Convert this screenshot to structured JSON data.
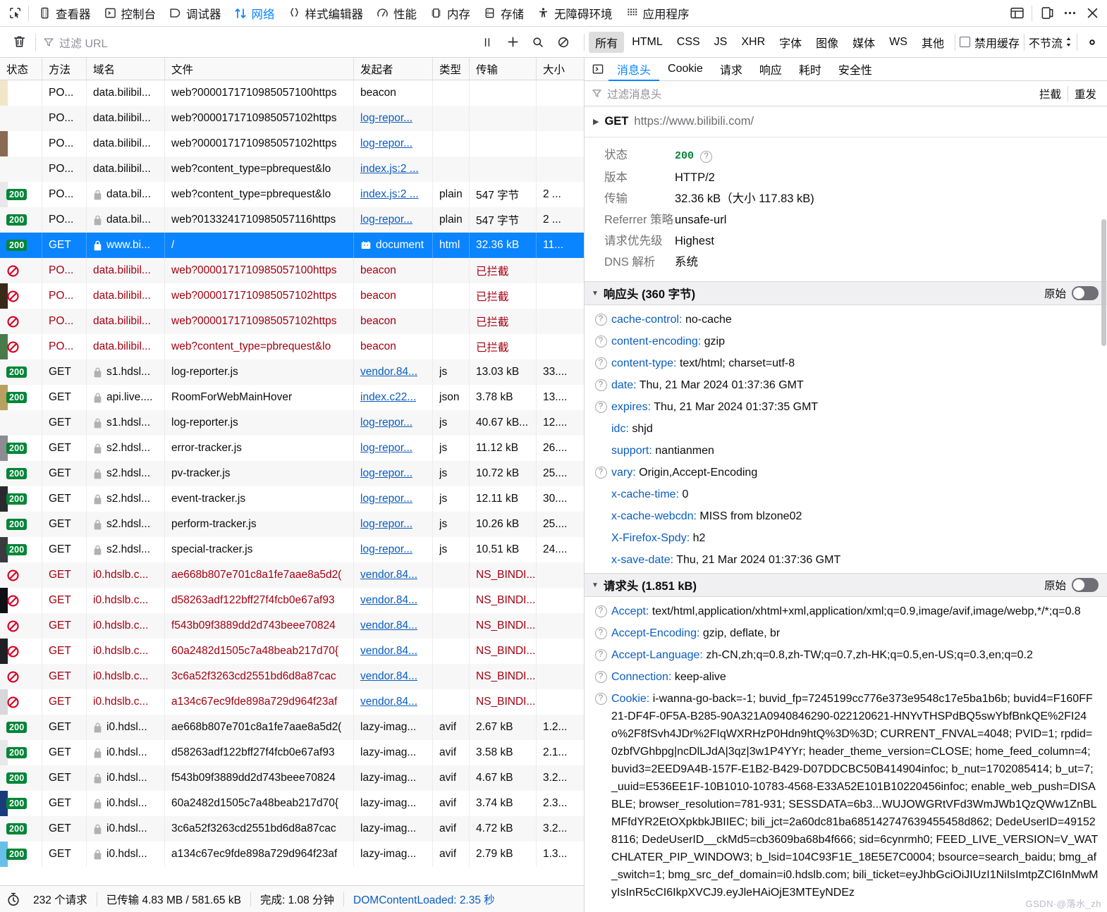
{
  "devtools_tabs": [
    {
      "label": "查看器",
      "icon": "inspector-icon",
      "active": false
    },
    {
      "label": "控制台",
      "icon": "console-icon",
      "active": false
    },
    {
      "label": "调试器",
      "icon": "debugger-icon",
      "active": false
    },
    {
      "label": "网络",
      "icon": "network-icon",
      "active": true
    },
    {
      "label": "样式编辑器",
      "icon": "style-editor-icon",
      "active": false
    },
    {
      "label": "性能",
      "icon": "performance-icon",
      "active": false
    },
    {
      "label": "内存",
      "icon": "memory-icon",
      "active": false
    },
    {
      "label": "存储",
      "icon": "storage-icon",
      "active": false
    },
    {
      "label": "无障碍环境",
      "icon": "accessibility-icon",
      "active": false
    },
    {
      "label": "应用程序",
      "icon": "application-icon",
      "active": false
    }
  ],
  "toolbar": {
    "clear_title": "clear",
    "filter_placeholder": "过滤 URL",
    "type_filters": [
      {
        "label": "所有",
        "selected": true
      },
      {
        "label": "HTML",
        "selected": false
      },
      {
        "label": "CSS",
        "selected": false
      },
      {
        "label": "JS",
        "selected": false
      },
      {
        "label": "XHR",
        "selected": false
      },
      {
        "label": "字体",
        "selected": false
      },
      {
        "label": "图像",
        "selected": false
      },
      {
        "label": "媒体",
        "selected": false
      },
      {
        "label": "WS",
        "selected": false
      },
      {
        "label": "其他",
        "selected": false
      }
    ],
    "disable_cache_label": "禁用缓存",
    "throttle_label": "不节流"
  },
  "table": {
    "columns": [
      "状态",
      "方法",
      "域名",
      "文件",
      "发起者",
      "类型",
      "传输",
      "大小"
    ],
    "rows": [
      {
        "status": "",
        "method": "PO...",
        "secure": false,
        "domain": "data.bilibil...",
        "file": "web?0000171710985057100https",
        "initiator": "beacon",
        "initiator_link": false,
        "type": "",
        "transfer": "",
        "size": "",
        "state": "pending",
        "edge": "#f2e6c8"
      },
      {
        "status": "",
        "method": "PO...",
        "secure": false,
        "domain": "data.bilibil...",
        "file": "web?0000171710985057102https",
        "initiator": "log-repor...",
        "initiator_link": true,
        "type": "",
        "transfer": "",
        "size": "",
        "state": "pending",
        "edge": "#b09070"
      },
      {
        "status": "",
        "method": "PO...",
        "secure": false,
        "domain": "data.bilibil...",
        "file": "web?0000171710985057102https",
        "initiator": "log-repor...",
        "initiator_link": true,
        "type": "",
        "transfer": "",
        "size": "",
        "state": "pending",
        "edge": "#8a6a52"
      },
      {
        "status": "",
        "method": "PO...",
        "secure": false,
        "domain": "data.bilibil...",
        "file": "web?content_type=pbrequest&lo",
        "initiator": "index.js:2 ...",
        "initiator_link": true,
        "type": "",
        "transfer": "",
        "size": "",
        "state": "pending",
        "edge": "#c8c8cc"
      },
      {
        "status": "200",
        "method": "PO...",
        "secure": true,
        "domain": "data.bil...",
        "file": "web?content_type=pbrequest&lo",
        "initiator": "index.js:2 ...",
        "initiator_link": true,
        "type": "plain",
        "transfer": "547 字节",
        "size": "2 ...",
        "state": "ok",
        "edge": "#e8e8ea"
      },
      {
        "status": "200",
        "method": "PO...",
        "secure": true,
        "domain": "data.bil...",
        "file": "web?0133241710985057116https",
        "initiator": "log-repor...",
        "initiator_link": true,
        "type": "plain",
        "transfer": "547 字节",
        "size": "2 ...",
        "state": "ok",
        "edge": "#e8e8ea"
      },
      {
        "status": "200",
        "method": "GET",
        "secure": true,
        "domain": "www.bi...",
        "file": "/",
        "initiator": "document",
        "initiator_link": false,
        "initiator_icon": "bilibili-favicon",
        "type": "html",
        "transfer": "32.36 kB",
        "size": "11...",
        "state": "selected",
        "edge": "#0a84ff"
      },
      {
        "status": "blocked",
        "method": "PO...",
        "secure": false,
        "domain": "data.bilibil...",
        "file": "web?0000171710985057100https",
        "initiator": "beacon",
        "initiator_link": false,
        "type": "",
        "transfer": "已拦截",
        "size": "",
        "state": "blocked",
        "edge": "#e8c98a"
      },
      {
        "status": "blocked",
        "method": "PO...",
        "secure": false,
        "domain": "data.bilibil...",
        "file": "web?0000171710985057102https",
        "initiator": "beacon",
        "initiator_link": false,
        "type": "",
        "transfer": "已拦截",
        "size": "",
        "state": "blocked",
        "edge": "#3a2a1a"
      },
      {
        "status": "blocked",
        "method": "PO...",
        "secure": false,
        "domain": "data.bilibil...",
        "file": "web?0000171710985057102https",
        "initiator": "beacon",
        "initiator_link": false,
        "type": "",
        "transfer": "已拦截",
        "size": "",
        "state": "blocked",
        "edge": "#2e6e3a"
      },
      {
        "status": "blocked",
        "method": "PO...",
        "secure": false,
        "domain": "data.bilibil...",
        "file": "web?content_type=pbrequest&lo",
        "initiator": "beacon",
        "initiator_link": false,
        "type": "",
        "transfer": "已拦截",
        "size": "",
        "state": "blocked",
        "edge": "#4a7a4a"
      },
      {
        "status": "200",
        "method": "GET",
        "secure": true,
        "domain": "s1.hdsl...",
        "file": "log-reporter.js",
        "initiator": "vendor.84...",
        "initiator_link": true,
        "type": "js",
        "transfer": "13.03 kB",
        "size": "33....",
        "state": "ok",
        "edge": "#6a8a4a"
      },
      {
        "status": "200",
        "method": "GET",
        "secure": true,
        "domain": "api.live....",
        "file": "RoomForWebMainHover",
        "initiator": "index.c22...",
        "initiator_link": true,
        "type": "json",
        "transfer": "3.78 kB",
        "size": "13....",
        "state": "ok",
        "edge": "#b8a060"
      },
      {
        "status": "",
        "method": "GET",
        "secure": true,
        "domain": "s1.hdsl...",
        "file": "log-reporter.js",
        "initiator": "log-repor...",
        "initiator_link": true,
        "type": "js",
        "transfer": "40.67 kB...",
        "size": "12....",
        "state": "pending",
        "edge": "#c0c0c4"
      },
      {
        "status": "200",
        "method": "GET",
        "secure": true,
        "domain": "s2.hdsl...",
        "file": "error-tracker.js",
        "initiator": "log-repor...",
        "initiator_link": true,
        "type": "js",
        "transfer": "11.12 kB",
        "size": "26....",
        "state": "ok",
        "edge": "#8c8c91"
      },
      {
        "status": "200",
        "method": "GET",
        "secure": true,
        "domain": "s2.hdsl...",
        "file": "pv-tracker.js",
        "initiator": "log-repor...",
        "initiator_link": true,
        "type": "js",
        "transfer": "10.72 kB",
        "size": "25....",
        "state": "ok",
        "edge": "#d8d8dc"
      },
      {
        "status": "200",
        "method": "GET",
        "secure": true,
        "domain": "s2.hdsl...",
        "file": "event-tracker.js",
        "initiator": "log-repor...",
        "initiator_link": true,
        "type": "js",
        "transfer": "12.11 kB",
        "size": "30....",
        "state": "ok",
        "edge": "#2a2a2e"
      },
      {
        "status": "200",
        "method": "GET",
        "secure": true,
        "domain": "s2.hdsl...",
        "file": "perform-tracker.js",
        "initiator": "log-repor...",
        "initiator_link": true,
        "type": "js",
        "transfer": "10.26 kB",
        "size": "25....",
        "state": "ok",
        "edge": "#1a1a1e"
      },
      {
        "status": "200",
        "method": "GET",
        "secure": true,
        "domain": "s2.hdsl...",
        "file": "special-tracker.js",
        "initiator": "log-repor...",
        "initiator_link": true,
        "type": "js",
        "transfer": "10.51 kB",
        "size": "24....",
        "state": "ok",
        "edge": "#3a3a40"
      },
      {
        "status": "blocked",
        "method": "GET",
        "secure": false,
        "domain": "i0.hdslb.c...",
        "file": "ae668b807e701c8a1fe7aae8a5d2(",
        "initiator": "vendor.84...",
        "initiator_link": true,
        "type": "",
        "transfer": "NS_BINDI...",
        "size": "",
        "state": "blocked",
        "edge": "#0a84ff"
      },
      {
        "status": "blocked",
        "method": "GET",
        "secure": false,
        "domain": "i0.hdslb.c...",
        "file": "d58263adf122bff27f4fcb0e67af93",
        "initiator": "vendor.84...",
        "initiator_link": true,
        "type": "",
        "transfer": "NS_BINDI...",
        "size": "",
        "state": "blocked",
        "edge": "#101014"
      },
      {
        "status": "blocked",
        "method": "GET",
        "secure": false,
        "domain": "i0.hdslb.c...",
        "file": "f543b09f3889dd2d743beee70824",
        "initiator": "vendor.84...",
        "initiator_link": true,
        "type": "",
        "transfer": "NS_BINDI...",
        "size": "",
        "state": "blocked",
        "edge": "#b01020"
      },
      {
        "status": "blocked",
        "method": "GET",
        "secure": false,
        "domain": "i0.hdslb.c...",
        "file": "60a2482d1505c7a48beab217d70{",
        "initiator": "vendor.84...",
        "initiator_link": true,
        "type": "",
        "transfer": "NS_BINDI...",
        "size": "",
        "state": "blocked",
        "edge": "#202024"
      },
      {
        "status": "blocked",
        "method": "GET",
        "secure": false,
        "domain": "i0.hdslb.c...",
        "file": "3c6a52f3263cd2551bd6d8a87cac",
        "initiator": "vendor.84...",
        "initiator_link": true,
        "type": "",
        "transfer": "NS_BINDI...",
        "size": "",
        "state": "blocked",
        "edge": "#c8c0a0"
      },
      {
        "status": "blocked",
        "method": "GET",
        "secure": false,
        "domain": "i0.hdslb.c...",
        "file": "a134c67ec9fde898a729d964f23af",
        "initiator": "vendor.84...",
        "initiator_link": true,
        "type": "",
        "transfer": "NS_BINDI...",
        "size": "",
        "state": "blocked",
        "edge": "#d8d8dc"
      },
      {
        "status": "200",
        "method": "GET",
        "secure": true,
        "domain": "i0.hdsl...",
        "file": "ae668b807e701c8a1fe7aae8a5d2(",
        "initiator": "lazy-imag...",
        "initiator_link": false,
        "type": "avif",
        "transfer": "2.67 kB",
        "size": "1.2...",
        "state": "ok",
        "edge": "#e8e8ea"
      },
      {
        "status": "200",
        "method": "GET",
        "secure": true,
        "domain": "i0.hdsl...",
        "file": "d58263adf122bff27f4fcb0e67af93",
        "initiator": "lazy-imag...",
        "initiator_link": false,
        "type": "avif",
        "transfer": "3.58 kB",
        "size": "2.1...",
        "state": "ok",
        "edge": "#e8e8ea"
      },
      {
        "status": "200",
        "method": "GET",
        "secure": true,
        "domain": "i0.hdsl...",
        "file": "f543b09f3889dd2d743beee70824",
        "initiator": "lazy-imag...",
        "initiator_link": false,
        "type": "avif",
        "transfer": "4.67 kB",
        "size": "3.2...",
        "state": "ok",
        "edge": "#e8e8ea"
      },
      {
        "status": "200",
        "method": "GET",
        "secure": true,
        "domain": "i0.hdsl...",
        "file": "60a2482d1505c7a48beab217d70{",
        "initiator": "lazy-imag...",
        "initiator_link": false,
        "type": "avif",
        "transfer": "3.74 kB",
        "size": "2.3...",
        "state": "ok",
        "edge": "#1a3a7a"
      },
      {
        "status": "200",
        "method": "GET",
        "secure": true,
        "domain": "i0.hdsl...",
        "file": "3c6a52f3263cd2551bd6d8a87cac",
        "initiator": "lazy-imag...",
        "initiator_link": false,
        "type": "avif",
        "transfer": "4.72 kB",
        "size": "3.2...",
        "state": "ok",
        "edge": "#e060a0"
      },
      {
        "status": "200",
        "method": "GET",
        "secure": true,
        "domain": "i0.hdsl...",
        "file": "a134c67ec9fde898a729d964f23af",
        "initiator": "lazy-imag...",
        "initiator_link": false,
        "type": "avif",
        "transfer": "2.79 kB",
        "size": "1.3...",
        "state": "ok",
        "edge": "#68c0e8"
      }
    ]
  },
  "statusbar": {
    "requests": "232 个请求",
    "transferred": "已传输 4.83 MB / 581.65 kB",
    "finish": "完成: 1.08 分钟",
    "dom_content_loaded": "DOMContentLoaded: 2.35 秒"
  },
  "details": {
    "tabs": [
      {
        "label": "消息头",
        "active": true
      },
      {
        "label": "Cookie",
        "active": false
      },
      {
        "label": "请求",
        "active": false
      },
      {
        "label": "响应",
        "active": false
      },
      {
        "label": "耗时",
        "active": false
      },
      {
        "label": "安全性",
        "active": false
      }
    ],
    "filter_placeholder": "过滤消息头",
    "actions": [
      "拦截",
      "重发"
    ],
    "request_line": {
      "method": "GET",
      "url": "https://www.bilibili.com/"
    },
    "summary": [
      {
        "key": "状态",
        "value": "200",
        "is_status": true
      },
      {
        "key": "版本",
        "value": "HTTP/2",
        "is_status": false
      },
      {
        "key": "传输",
        "value": "32.36 kB（大小 117.83 kB)",
        "is_status": false
      },
      {
        "key": "Referrer 策略",
        "value": "unsafe-url",
        "is_status": false
      },
      {
        "key": "请求优先级",
        "value": "Highest",
        "is_status": false
      },
      {
        "key": "DNS 解析",
        "value": "系统",
        "is_status": false
      }
    ],
    "response_headers": {
      "title": "响应头 (360 字节)",
      "raw_label": "原始",
      "items": [
        {
          "name": "cache-control:",
          "value": "no-cache",
          "has_help": true
        },
        {
          "name": "content-encoding:",
          "value": "gzip",
          "has_help": true
        },
        {
          "name": "content-type:",
          "value": "text/html; charset=utf-8",
          "has_help": true
        },
        {
          "name": "date:",
          "value": "Thu, 21 Mar 2024 01:37:36 GMT",
          "has_help": true
        },
        {
          "name": "expires:",
          "value": "Thu, 21 Mar 2024 01:37:35 GMT",
          "has_help": true
        },
        {
          "name": "idc:",
          "value": "shjd",
          "has_help": false
        },
        {
          "name": "support:",
          "value": "nantianmen",
          "has_help": false
        },
        {
          "name": "vary:",
          "value": "Origin,Accept-Encoding",
          "has_help": true
        },
        {
          "name": "x-cache-time:",
          "value": "0",
          "has_help": false
        },
        {
          "name": "x-cache-webcdn:",
          "value": "MISS from blzone02",
          "has_help": false
        },
        {
          "name": "X-Firefox-Spdy:",
          "value": "h2",
          "has_help": false
        },
        {
          "name": "x-save-date:",
          "value": "Thu, 21 Mar 2024 01:37:36 GMT",
          "has_help": false
        }
      ]
    },
    "request_headers": {
      "title": "请求头 (1.851 kB)",
      "raw_label": "原始",
      "items": [
        {
          "name": "Accept:",
          "value": "text/html,application/xhtml+xml,application/xml;q=0.9,image/avif,image/webp,*/*;q=0.8",
          "has_help": true
        },
        {
          "name": "Accept-Encoding:",
          "value": "gzip, deflate, br",
          "has_help": true
        },
        {
          "name": "Accept-Language:",
          "value": "zh-CN,zh;q=0.8,zh-TW;q=0.7,zh-HK;q=0.5,en-US;q=0.3,en;q=0.2",
          "has_help": true
        },
        {
          "name": "Connection:",
          "value": "keep-alive",
          "has_help": true
        },
        {
          "name": "Cookie:",
          "value": "i-wanna-go-back=-1; buvid_fp=7245199cc776e373e9548c17e5ba1b6b; buvid4=F160FF21-DF4F-0F5A-B285-90A321A0940846290-022120621-HNYvTHSPdBQ5swYbfBnkQE%2FI24o%2F8fSvh4JDr%2FIqWXRHzP0Hdn9htQ%3D%3D; CURRENT_FNVAL=4048; PVID=1; rpdid=0zbfVGhbpg|ncDlLJdA|3qz|3w1P4YYr; header_theme_version=CLOSE; home_feed_column=4; buvid3=2EED9A4B-157F-E1B2-B429-D07DDCBC50B414904infoc; b_nut=1702085414; b_ut=7; _uuid=E536EE1F-10B1010-10783-4568-E33A52E101B10220456infoc; enable_web_push=DISABLE; browser_resolution=781-931; SESSDATA=6b3...WUJOWGRtVFd3WmJWb1QzQWw1ZnBLMFfdYR2EtOXpkbkJBIIEC; bili_jct=2a60dc81ba685142747639455458d862; DedeUserID=491528116; DedeUserID__ckMd5=cb3609ba68b4f666; sid=6cynrmh0; FEED_LIVE_VERSION=V_WATCHLATER_PIP_WINDOW3; b_lsid=104C93F1E_18E5E7C0004; bsource=search_baidu; bmg_af_switch=1; bmg_src_def_domain=i0.hdslb.com; bili_ticket=eyJhbGciOiJIUzI1NiIsImtpZCI6InMwMyIsInR5cCI6IkpXVCJ9.eyJleHAiOjE3MTEyNDEz",
          "has_help": true
        }
      ]
    }
  },
  "watermark": "GSDN·@落水_zh"
}
